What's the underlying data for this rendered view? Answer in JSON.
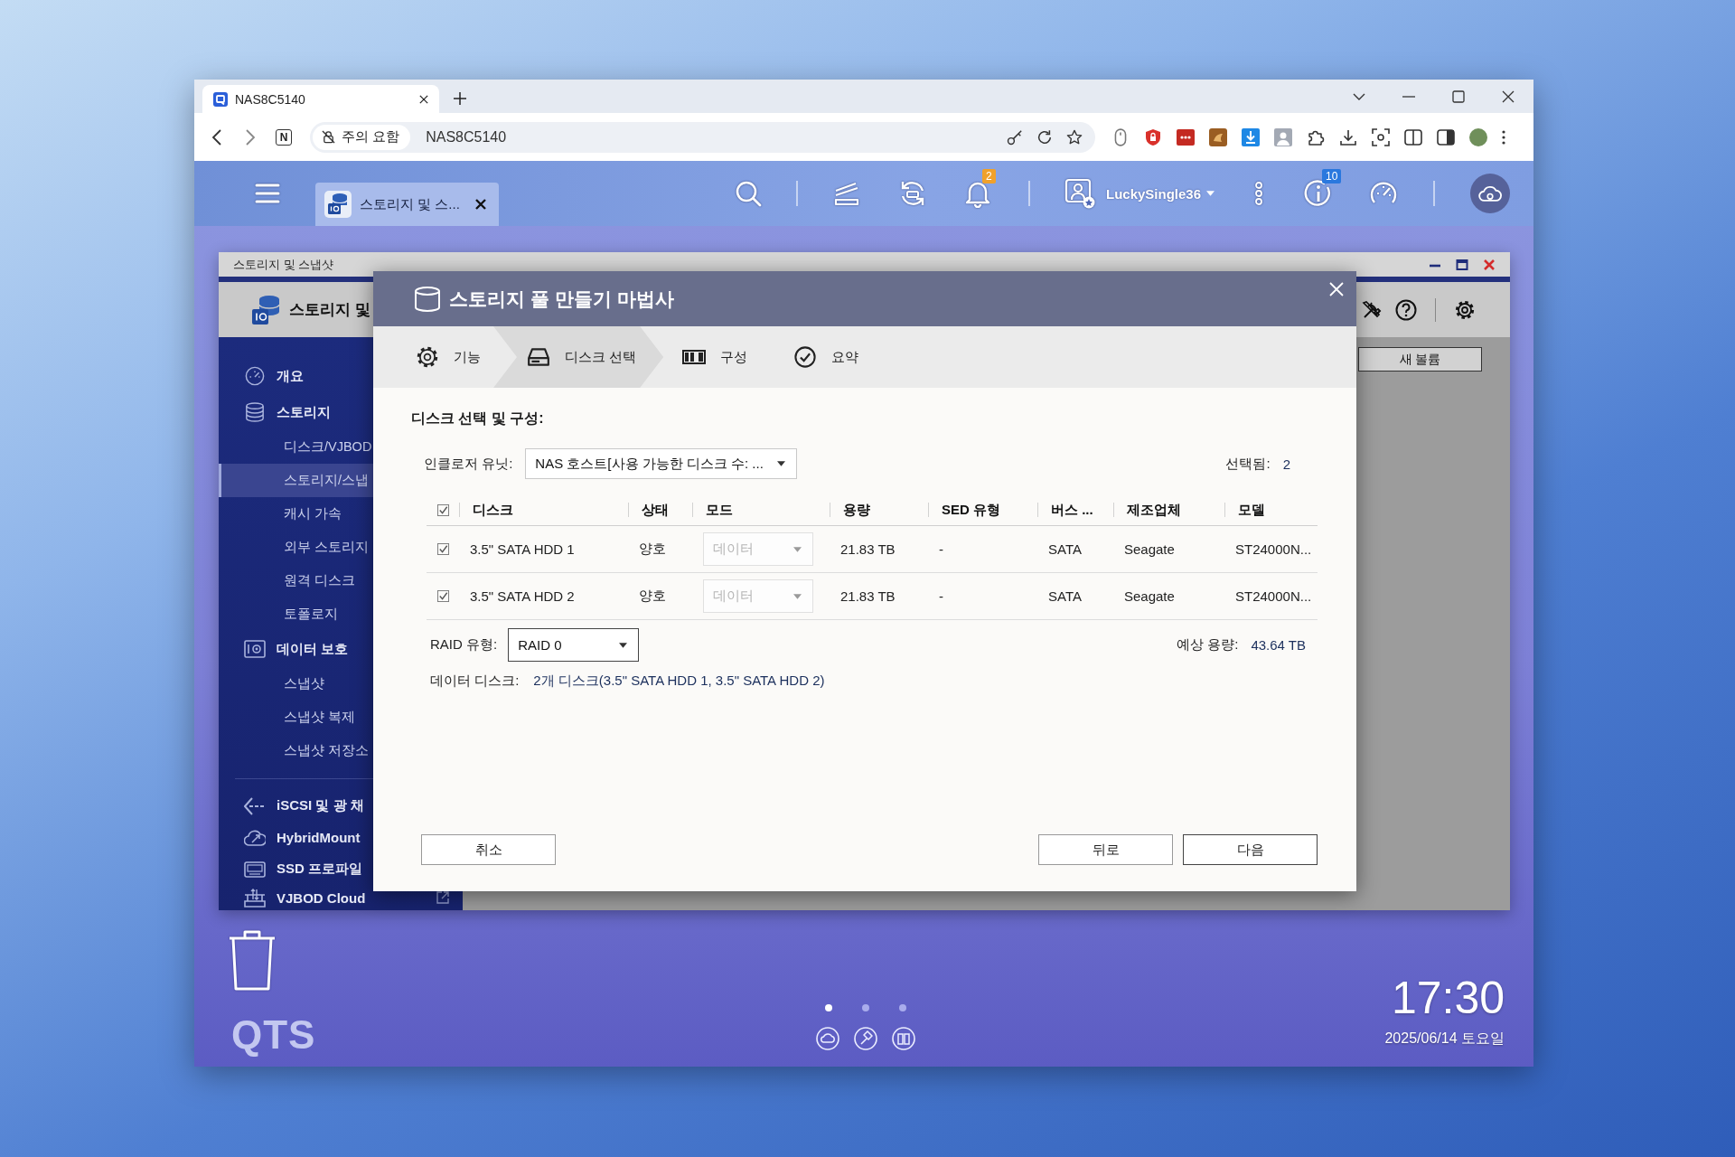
{
  "browser": {
    "tabs": [
      {
        "title": "NAS8C5140",
        "selected": true
      }
    ],
    "toolbar": {
      "letter_button": "N",
      "security_chip": "주의 요함",
      "url": "NAS8C5140"
    }
  },
  "qts": {
    "top_bar": {
      "app_tabs": [
        {
          "label": "스토리지 및 스...",
          "selected": true
        }
      ],
      "notification_badge": "2",
      "user": "LuckySingle36",
      "info_badge": "10"
    },
    "window": {
      "title": "스토리지 및 스냅샷",
      "app_title": "스토리지 및",
      "sidebar": {
        "sections": [
          {
            "items": [
              {
                "label": "개요",
                "selected": false,
                "external": false
              },
              {
                "label": "스토리지",
                "selected": false,
                "external": false,
                "children": [
                  {
                    "label": "디스크/VJBOD",
                    "selected": false
                  },
                  {
                    "label": "스토리지/스냅",
                    "selected": true
                  },
                  {
                    "label": "캐시 가속",
                    "selected": false
                  },
                  {
                    "label": "외부 스토리지",
                    "selected": false
                  },
                  {
                    "label": "원격 디스크",
                    "selected": false
                  },
                  {
                    "label": "토폴로지",
                    "selected": false
                  }
                ]
              },
              {
                "label": "데이터 보호",
                "selected": false,
                "external": false,
                "children": [
                  {
                    "label": "스냅샷",
                    "selected": false
                  },
                  {
                    "label": "스냅샷 복제",
                    "selected": false
                  },
                  {
                    "label": "스냅샷 저장소",
                    "selected": false
                  }
                ]
              }
            ]
          },
          {
            "items": [
              {
                "label": "iSCSI 및 광 채",
                "selected": false,
                "external": false
              },
              {
                "label": "HybridMount",
                "selected": false,
                "external": false
              },
              {
                "label": "SSD 프로파일",
                "selected": false,
                "external": false
              },
              {
                "label": "VJBOD Cloud",
                "selected": false,
                "external": true
              }
            ]
          }
        ]
      },
      "new_volume_button": "새 볼륨"
    },
    "dialog": {
      "title": "스토리지 풀 만들기 마법사",
      "steps": [
        {
          "label": "기능",
          "selected": false
        },
        {
          "label": "디스크 선택",
          "selected": true
        },
        {
          "label": "구성",
          "selected": false
        },
        {
          "label": "요약",
          "selected": false
        }
      ],
      "section_title": "디스크 선택 및 구성:",
      "enclosure": {
        "label": "인클로저 유닛:",
        "value": "NAS 호스트[사용 가능한 디스크 수: ..."
      },
      "selected_count": {
        "label": "선택됨:",
        "value": "2"
      },
      "disk_table": {
        "all_checked": true,
        "columns": [
          "디스크",
          "상태",
          "모드",
          "용량",
          "SED 유형",
          "버스 ...",
          "제조업체",
          "모델"
        ],
        "rows": [
          {
            "checked": true,
            "disk": "3.5\" SATA HDD 1",
            "status": "양호",
            "mode": "데이터",
            "mode_disabled": true,
            "capacity": "21.83 TB",
            "sed_type": "-",
            "bus": "SATA",
            "manufacturer": "Seagate",
            "model": "ST24000N..."
          },
          {
            "checked": true,
            "disk": "3.5\" SATA HDD 2",
            "status": "양호",
            "mode": "데이터",
            "mode_disabled": true,
            "capacity": "21.83 TB",
            "sed_type": "-",
            "bus": "SATA",
            "manufacturer": "Seagate",
            "model": "ST24000N..."
          }
        ]
      },
      "raid_type": {
        "label": "RAID 유형:",
        "value": "RAID 0"
      },
      "estimated_capacity": {
        "label": "예상 용량:",
        "value": "43.64 TB"
      },
      "data_disks": {
        "label": "데이터 디스크:",
        "value": "2개 디스크(3.5\" SATA HDD 1, 3.5\" SATA HDD 2)"
      },
      "buttons": {
        "cancel": "취소",
        "back": "뒤로",
        "next": "다음"
      }
    },
    "desktop": {
      "logo": "QTS",
      "pages": [
        {
          "selected": true
        },
        {
          "selected": false
        },
        {
          "selected": false
        }
      ],
      "clock": {
        "time": "17:30",
        "date": "2025/06/14 토요일"
      }
    }
  }
}
